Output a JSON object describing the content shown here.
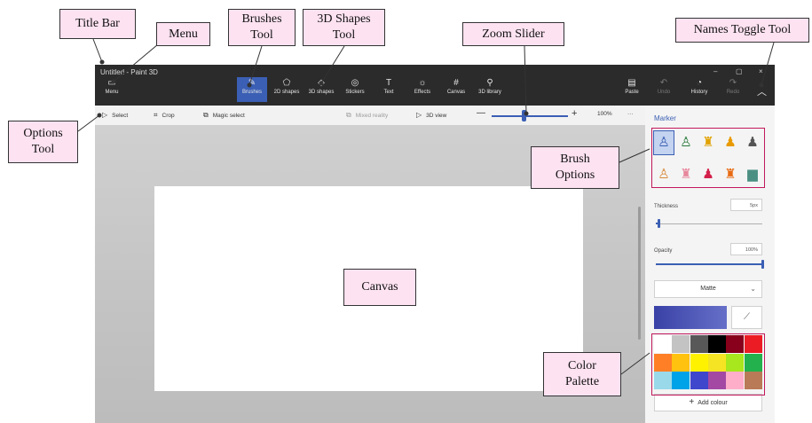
{
  "app": {
    "title": "Untitled - Paint 3D",
    "window_controls": [
      "–",
      "▢",
      "×"
    ]
  },
  "toolbar": {
    "menu": "Menu",
    "tools": [
      "Brushes",
      "2D shapes",
      "3D shapes",
      "Stickers",
      "Text",
      "Effects",
      "Canvas",
      "3D library"
    ],
    "right": [
      "Paste",
      "Undo",
      "History",
      "Redo"
    ]
  },
  "options_bar": {
    "select": "Select",
    "crop": "Crop",
    "magic_select": "Magic select",
    "mixed_reality": "Mixed reality",
    "view_3d": "3D view",
    "zoom_minus": "—",
    "zoom_plus": "+",
    "zoom_percent": "100%",
    "more": "···",
    "zoom_level": 0.42
  },
  "side_panel": {
    "title": "Marker",
    "thickness_label": "Thickness",
    "thickness_value": "5px",
    "thickness_level": 0.03,
    "opacity_label": "Opacity",
    "opacity_value": "100%",
    "opacity_level": 1.0,
    "finish": "Matte",
    "current_color": "#3a41a6",
    "palette": [
      "#ffffff",
      "#c3c3c3",
      "#585858",
      "#000000",
      "#88001b",
      "#ec1c24",
      "#ff7f27",
      "#ffc20e",
      "#fff200",
      "#f5e423",
      "#a8e61d",
      "#22b14c",
      "#99d9ea",
      "#00a2e8",
      "#3f48cc",
      "#a349a4",
      "#ffaec9",
      "#b97a57"
    ],
    "add_colour": "Add colour"
  },
  "callouts": {
    "title_bar": "Title Bar",
    "menu": "Menu",
    "brushes_tool": [
      "Brushes",
      "Tool"
    ],
    "shapes_3d_tool": [
      "3D Shapes",
      "Tool"
    ],
    "zoom_slider": "Zoom Slider",
    "names_toggle": "Names Toggle Tool",
    "options_tool": [
      "Options",
      "Tool"
    ],
    "brush_options": [
      "Brush",
      "Options"
    ],
    "canvas": "Canvas",
    "color_palette": [
      "Color",
      "Palette"
    ]
  },
  "colors": {
    "accent": "#3b5fb4",
    "callout_fill": "#fde2f1",
    "highlight": "#c2185b"
  }
}
